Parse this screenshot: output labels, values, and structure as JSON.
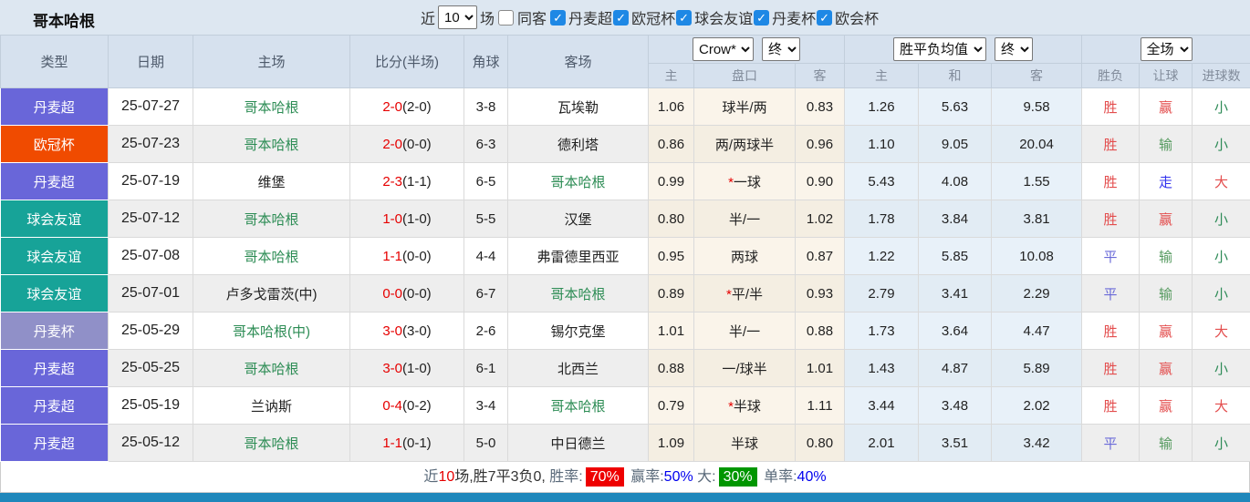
{
  "topbar": {
    "team_title": "哥本哈根",
    "recent_label": "近",
    "recent_count": "10",
    "matches_label": "场",
    "same_venue": {
      "label": "同客",
      "checked": false
    },
    "leagues": [
      {
        "label": "丹麦超",
        "checked": true
      },
      {
        "label": "欧冠杯",
        "checked": true
      },
      {
        "label": "球会友谊",
        "checked": true
      },
      {
        "label": "丹麦杯",
        "checked": true
      },
      {
        "label": "欧会杯",
        "checked": true
      }
    ]
  },
  "table": {
    "columns": [
      "类型",
      "日期",
      "主场",
      "比分(半场)",
      "角球",
      "客场"
    ],
    "selects": {
      "provider": "Crow*",
      "provider_time": "终",
      "avg": "胜平负均值",
      "avg_time": "终",
      "scope": "全场"
    },
    "sub_columns": [
      "主",
      "盘口",
      "客",
      "主",
      "和",
      "客",
      "胜负",
      "让球",
      "进球数"
    ],
    "rows": [
      {
        "type": "丹麦超",
        "date": "25-07-27",
        "home": "哥本哈根",
        "home_focus": true,
        "score": "2-0",
        "half": "(2-0)",
        "corner": "3-8",
        "away": "瓦埃勒",
        "away_focus": false,
        "h_home": "1.06",
        "handicap": "球半/两",
        "h_away": "0.83",
        "avg_home": "1.26",
        "avg_draw": "5.63",
        "avg_away": "9.58",
        "result": "胜",
        "hc_result": "赢",
        "goals": "小"
      },
      {
        "type": "欧冠杯",
        "date": "25-07-23",
        "home": "哥本哈根",
        "home_focus": true,
        "score": "2-0",
        "half": "(0-0)",
        "corner": "6-3",
        "away": "德利塔",
        "away_focus": false,
        "h_home": "0.86",
        "handicap": "两/两球半",
        "h_away": "0.96",
        "avg_home": "1.10",
        "avg_draw": "9.05",
        "avg_away": "20.04",
        "result": "胜",
        "hc_result": "输",
        "goals": "小"
      },
      {
        "type": "丹麦超",
        "date": "25-07-19",
        "home": "维堡",
        "home_focus": false,
        "score": "2-3",
        "half": "(1-1)",
        "corner": "6-5",
        "away": "哥本哈根",
        "away_focus": true,
        "h_home": "0.99",
        "handicap": "*一球",
        "h_away": "0.90",
        "avg_home": "5.43",
        "avg_draw": "4.08",
        "avg_away": "1.55",
        "result": "胜",
        "hc_result": "走",
        "goals": "大"
      },
      {
        "type": "球会友谊",
        "date": "25-07-12",
        "home": "哥本哈根",
        "home_focus": true,
        "score": "1-0",
        "half": "(1-0)",
        "corner": "5-5",
        "away": "汉堡",
        "away_focus": false,
        "h_home": "0.80",
        "handicap": "半/一",
        "h_away": "1.02",
        "avg_home": "1.78",
        "avg_draw": "3.84",
        "avg_away": "3.81",
        "result": "胜",
        "hc_result": "赢",
        "goals": "小"
      },
      {
        "type": "球会友谊",
        "date": "25-07-08",
        "home": "哥本哈根",
        "home_focus": true,
        "score": "1-1",
        "half": "(0-0)",
        "corner": "4-4",
        "away": "弗雷德里西亚",
        "away_focus": false,
        "h_home": "0.95",
        "handicap": "两球",
        "h_away": "0.87",
        "avg_home": "1.22",
        "avg_draw": "5.85",
        "avg_away": "10.08",
        "result": "平",
        "hc_result": "输",
        "goals": "小"
      },
      {
        "type": "球会友谊",
        "date": "25-07-01",
        "home": "卢多戈雷茨(中)",
        "home_focus": false,
        "score": "0-0",
        "half": "(0-0)",
        "corner": "6-7",
        "away": "哥本哈根",
        "away_focus": true,
        "h_home": "0.89",
        "handicap": "*平/半",
        "h_away": "0.93",
        "avg_home": "2.79",
        "avg_draw": "3.41",
        "avg_away": "2.29",
        "result": "平",
        "hc_result": "输",
        "goals": "小"
      },
      {
        "type": "丹麦杯",
        "date": "25-05-29",
        "home": "哥本哈根(中)",
        "home_focus": true,
        "score": "3-0",
        "half": "(3-0)",
        "corner": "2-6",
        "away": "锡尔克堡",
        "away_focus": false,
        "h_home": "1.01",
        "handicap": "半/一",
        "h_away": "0.88",
        "avg_home": "1.73",
        "avg_draw": "3.64",
        "avg_away": "4.47",
        "result": "胜",
        "hc_result": "赢",
        "goals": "大"
      },
      {
        "type": "丹麦超",
        "date": "25-05-25",
        "home": "哥本哈根",
        "home_focus": true,
        "score": "3-0",
        "half": "(1-0)",
        "corner": "6-1",
        "away": "北西兰",
        "away_focus": false,
        "h_home": "0.88",
        "handicap": "一/球半",
        "h_away": "1.01",
        "avg_home": "1.43",
        "avg_draw": "4.87",
        "avg_away": "5.89",
        "result": "胜",
        "hc_result": "赢",
        "goals": "小"
      },
      {
        "type": "丹麦超",
        "date": "25-05-19",
        "home": "兰讷斯",
        "home_focus": false,
        "score": "0-4",
        "half": "(0-2)",
        "corner": "3-4",
        "away": "哥本哈根",
        "away_focus": true,
        "h_home": "0.79",
        "handicap": "*半球",
        "h_away": "1.11",
        "avg_home": "3.44",
        "avg_draw": "3.48",
        "avg_away": "2.02",
        "result": "胜",
        "hc_result": "赢",
        "goals": "大"
      },
      {
        "type": "丹麦超",
        "date": "25-05-12",
        "home": "哥本哈根",
        "home_focus": true,
        "score": "1-1",
        "half": "(0-1)",
        "corner": "5-0",
        "away": "中日德兰",
        "away_focus": false,
        "h_home": "1.09",
        "handicap": "半球",
        "h_away": "0.80",
        "avg_home": "2.01",
        "avg_draw": "3.51",
        "avg_away": "3.42",
        "result": "平",
        "hc_result": "输",
        "goals": "小"
      }
    ]
  },
  "summary": {
    "prefix": "近",
    "count": "10",
    "mid": "场,胜7平3负0, ",
    "win_rate_label": "胜率:",
    "win_rate": "70%",
    "handicap_label": "赢率:",
    "handicap_rate": "50%",
    "big_label": "大:",
    "big_rate": "30%",
    "single_label": "单率:",
    "single_rate": "40%"
  },
  "colors": {
    "checkbox_accent": "#1e88e5",
    "type_badges": {
      "丹麦超": "#6966d9",
      "欧冠杯": "#f04b00",
      "球会友谊": "#17a398",
      "丹麦杯": "#9090c8"
    },
    "result": {
      "胜": "#e34d4d",
      "平": "#6a6ad8",
      "负": "#4f9a65"
    },
    "handicap_result": {
      "赢": "#e34d4d",
      "输": "#559a5f",
      "走": "#3333ee"
    },
    "goals": {
      "大": "#e34d4d",
      "小": "#2e8b57"
    },
    "team_focus": "#2c8c54",
    "score_red": "#e60000",
    "win_badge_bg": "#ee0000",
    "big_badge_bg": "#009600",
    "bottom_bar": "#1f87bb"
  }
}
